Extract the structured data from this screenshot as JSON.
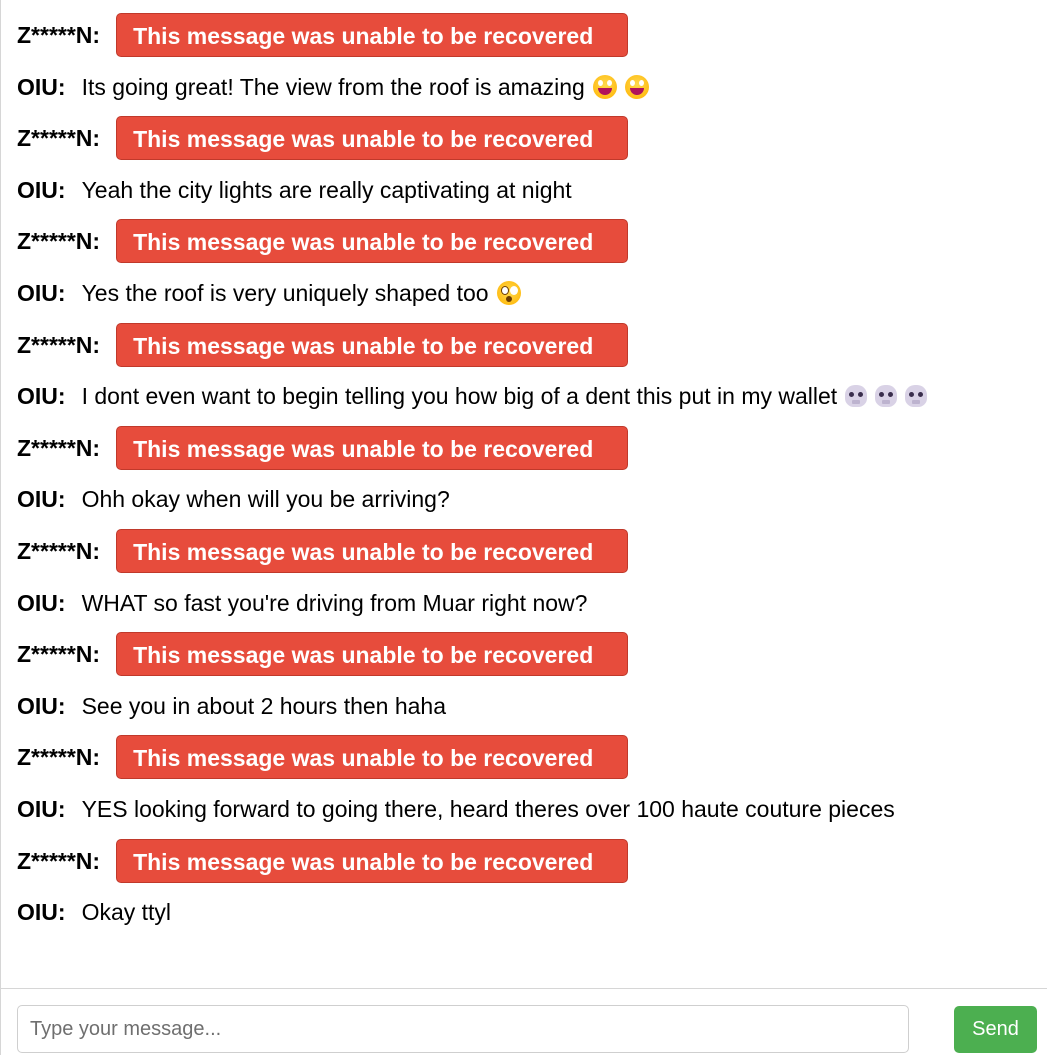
{
  "senders": {
    "z": "Z*****N:",
    "o": "OIU:"
  },
  "unrecovered_text": "This message was unable to be recovered",
  "messages": [
    {
      "type": "unrecovered"
    },
    {
      "type": "text",
      "text": "Its going great! The view from the roof is amazing",
      "emojis": [
        "grinning-face-icon",
        "grinning-face-icon"
      ]
    },
    {
      "type": "unrecovered"
    },
    {
      "type": "text",
      "text": "Yeah the city lights are really captivating at night",
      "emojis": []
    },
    {
      "type": "unrecovered"
    },
    {
      "type": "text",
      "text": "Yes the roof is very uniquely shaped too",
      "emojis": [
        "flushed-face-icon"
      ]
    },
    {
      "type": "unrecovered"
    },
    {
      "type": "text",
      "text": "I dont even want to begin telling you how big of a dent this put in my wallet",
      "emojis": [
        "skull-icon",
        "skull-icon",
        "skull-icon"
      ]
    },
    {
      "type": "unrecovered"
    },
    {
      "type": "text",
      "text": "Ohh okay when will you be arriving?",
      "emojis": []
    },
    {
      "type": "unrecovered"
    },
    {
      "type": "text",
      "text": "WHAT so fast you're driving from Muar right now?",
      "emojis": []
    },
    {
      "type": "unrecovered"
    },
    {
      "type": "text",
      "text": "See you in about 2 hours then haha",
      "emojis": []
    },
    {
      "type": "unrecovered"
    },
    {
      "type": "text",
      "text": "YES looking forward to going there, heard theres over 100 haute couture pieces",
      "emojis": []
    },
    {
      "type": "unrecovered"
    },
    {
      "type": "text",
      "text": "Okay ttyl",
      "emojis": []
    }
  ],
  "composer": {
    "placeholder": "Type your message...",
    "value": "",
    "send_label": "Send"
  },
  "colors": {
    "unrecovered_bg": "#e74c3c",
    "send_bg": "#4caf50"
  }
}
